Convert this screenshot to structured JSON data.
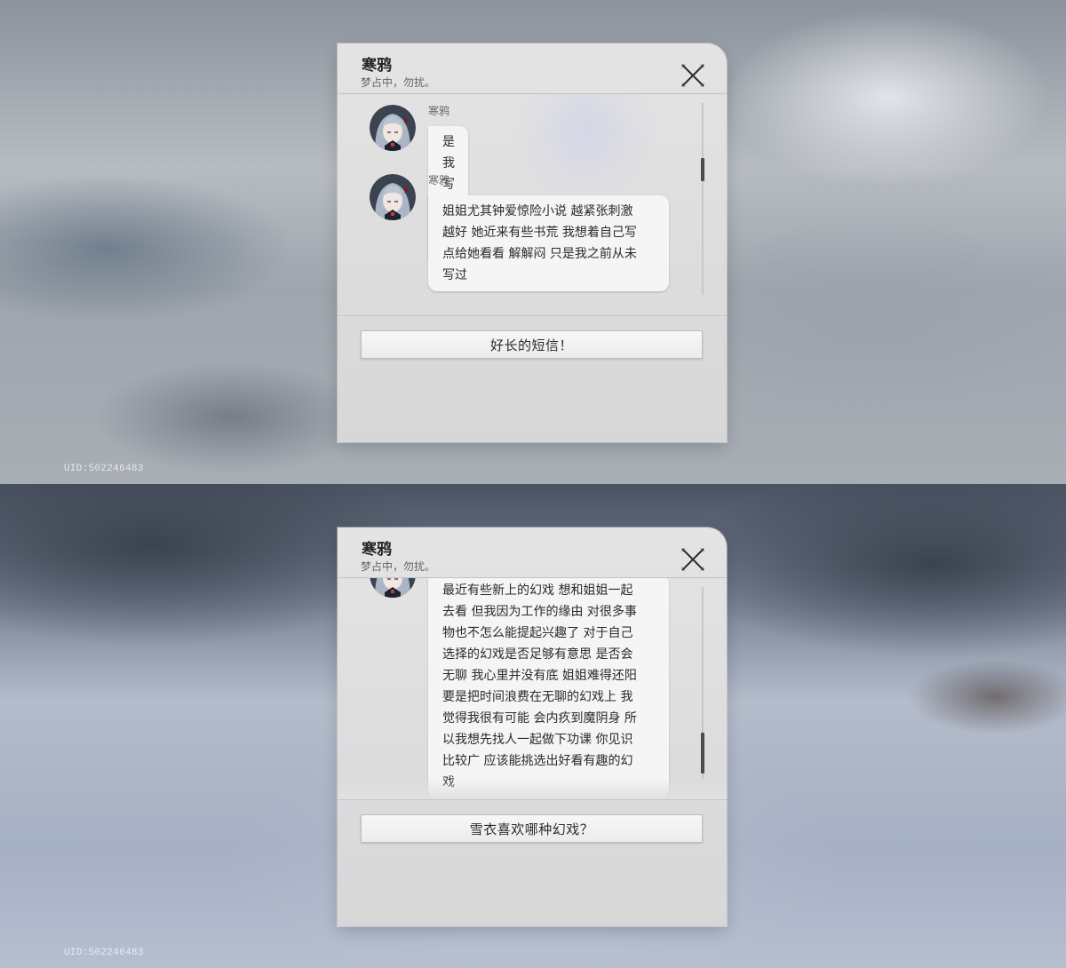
{
  "uid_label": "UID:502246483",
  "screens": [
    {
      "header": {
        "title": "寒鸦",
        "status": "梦占中，勿扰。"
      },
      "messages": [
        {
          "sender": "寒鸦",
          "text": "是我写的 小说"
        },
        {
          "sender": "寒鸦",
          "lines": [
            "姐姐尤其钟爱惊险小说 越紧张刺激",
            "越好 她近来有些书荒 我想着自己写",
            "点给她看看 解解闷 只是我之前从未",
            "写过"
          ]
        }
      ],
      "reply_label": "好长的短信！",
      "scroll_position": 0.35
    },
    {
      "header": {
        "title": "寒鸦",
        "status": "梦占中，勿扰。"
      },
      "messages": [
        {
          "lines": [
            "最近有些新上的幻戏 想和姐姐一起",
            "去看 但我因为工作的缘由 对很多事",
            "物也不怎么能提起兴趣了 对于自己",
            "选择的幻戏是否足够有意思 是否会",
            "无聊 我心里并没有底 姐姐难得还阳",
            "要是把时间浪费在无聊的幻戏上 我",
            "觉得我很有可能 会内疚到魔阴身 所",
            "以我想先找人一起做下功课 你见识",
            "比较广 应该能挑选出好看有趣的幻",
            "戏"
          ]
        }
      ],
      "reply_label": "雪衣喜欢哪种幻戏？",
      "scroll_position": 0.8
    }
  ],
  "colors": {
    "bubble": "#f5f5f6",
    "dialog": "#e0e0e1",
    "scroll_thumb": "#4b4b4b"
  },
  "icons": {
    "close": "close-x-icon",
    "more": "chevron-double-down-icon",
    "avatar": "avatar-portrait-icon"
  }
}
